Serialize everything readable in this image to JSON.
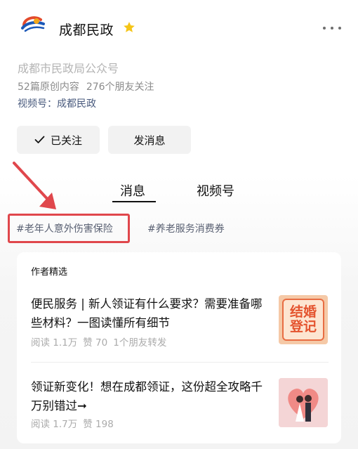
{
  "account": {
    "name": "成都民政",
    "logo_text": "成都民政",
    "description": "成都市民政局公众号",
    "original_count": "52篇原创内容",
    "friends_following": "276个朋友关注",
    "video_channel": "视频号：成都民政"
  },
  "buttons": {
    "followed_label": "已关注",
    "message_label": "发消息"
  },
  "tabs": [
    {
      "label": "消息",
      "active": true
    },
    {
      "label": "视频号",
      "active": false
    }
  ],
  "topics": [
    "#老年人意外伤害保险",
    "#养老服务消费券"
  ],
  "featured": {
    "title": "作者精选",
    "articles": [
      {
        "title": "便民服务 | 新人领证有什么要求？需要准备哪些材料？一图读懂所有细节",
        "reads": "阅读 1.1万",
        "likes": "赞 70",
        "shares": "1个朋友转发",
        "thumb_text": [
          "结婚",
          "登记"
        ]
      },
      {
        "title": "领证新变化！想在成都领证，这份超全攻略千万别错过➞",
        "reads": "阅读 1.7万",
        "likes": "赞 198"
      }
    ]
  },
  "colors": {
    "highlight": "#e0474c",
    "star": "#f5c518",
    "link": "#4a5b7e"
  }
}
